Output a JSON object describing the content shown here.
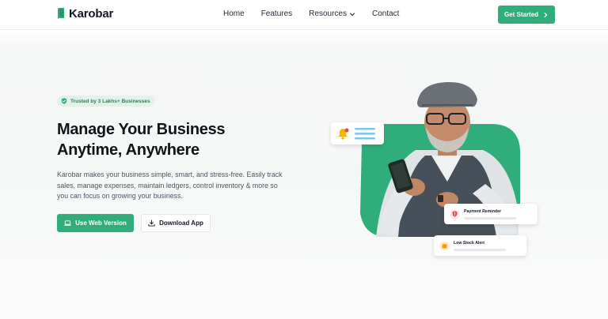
{
  "header": {
    "brand": "Karobar",
    "nav": [
      {
        "label": "Home"
      },
      {
        "label": "Features"
      },
      {
        "label": "Resources"
      },
      {
        "label": "Contact"
      }
    ],
    "cta_label": "Get Started"
  },
  "hero": {
    "badge": "Trusted by 3 Lakhs+ Businesses",
    "title_line1": "Manage Your Business",
    "title_line2": "Anytime, Anywhere",
    "description": "Karobar makes your business simple, smart, and stress-free. Easily track sales, manage expenses, maintain ledgers, control inventory & more so you can focus on growing your business.",
    "primary_button": "Use Web Version",
    "secondary_button": "Download App"
  },
  "notifications": {
    "payment": "Payment Reminder",
    "stock": "Low Stock Alert"
  },
  "colors": {
    "brand_green": "#2fae7b",
    "badge_bg": "#dff3e9",
    "alert_red": "#e5484d",
    "alert_orange": "#f59e0b"
  },
  "icons": {
    "logo": "book-logo-icon",
    "resources_dropdown": "chevron-down-icon",
    "cta": "chevron-right-icon",
    "badge": "shield-check-icon",
    "web": "laptop-icon",
    "download": "download-icon",
    "payment": "shield-alert-icon",
    "stock": "box-icon",
    "chat": "bell-icon"
  }
}
